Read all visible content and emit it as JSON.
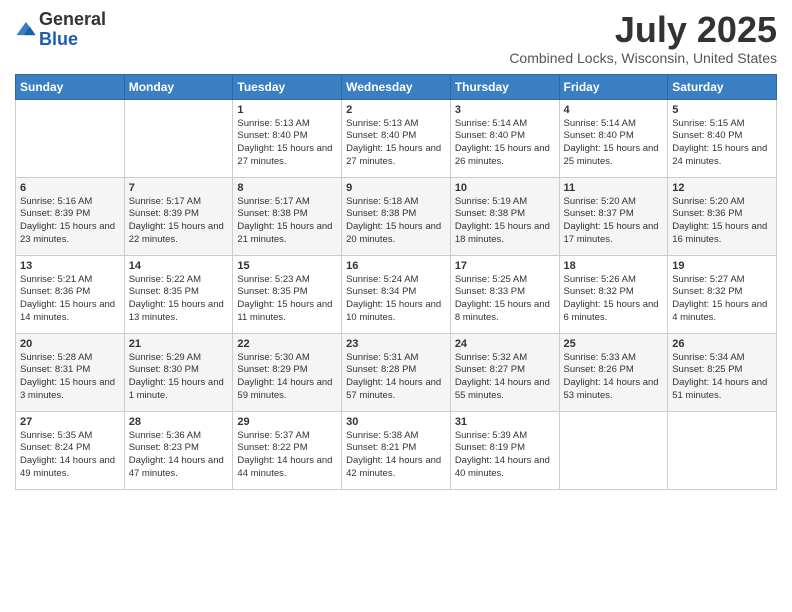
{
  "header": {
    "logo_general": "General",
    "logo_blue": "Blue",
    "month_year": "July 2025",
    "location": "Combined Locks, Wisconsin, United States"
  },
  "days_of_week": [
    "Sunday",
    "Monday",
    "Tuesday",
    "Wednesday",
    "Thursday",
    "Friday",
    "Saturday"
  ],
  "weeks": [
    [
      {
        "day": "",
        "sunrise": "",
        "sunset": "",
        "daylight": ""
      },
      {
        "day": "",
        "sunrise": "",
        "sunset": "",
        "daylight": ""
      },
      {
        "day": "1",
        "sunrise": "Sunrise: 5:13 AM",
        "sunset": "Sunset: 8:40 PM",
        "daylight": "Daylight: 15 hours and 27 minutes."
      },
      {
        "day": "2",
        "sunrise": "Sunrise: 5:13 AM",
        "sunset": "Sunset: 8:40 PM",
        "daylight": "Daylight: 15 hours and 27 minutes."
      },
      {
        "day": "3",
        "sunrise": "Sunrise: 5:14 AM",
        "sunset": "Sunset: 8:40 PM",
        "daylight": "Daylight: 15 hours and 26 minutes."
      },
      {
        "day": "4",
        "sunrise": "Sunrise: 5:14 AM",
        "sunset": "Sunset: 8:40 PM",
        "daylight": "Daylight: 15 hours and 25 minutes."
      },
      {
        "day": "5",
        "sunrise": "Sunrise: 5:15 AM",
        "sunset": "Sunset: 8:40 PM",
        "daylight": "Daylight: 15 hours and 24 minutes."
      }
    ],
    [
      {
        "day": "6",
        "sunrise": "Sunrise: 5:16 AM",
        "sunset": "Sunset: 8:39 PM",
        "daylight": "Daylight: 15 hours and 23 minutes."
      },
      {
        "day": "7",
        "sunrise": "Sunrise: 5:17 AM",
        "sunset": "Sunset: 8:39 PM",
        "daylight": "Daylight: 15 hours and 22 minutes."
      },
      {
        "day": "8",
        "sunrise": "Sunrise: 5:17 AM",
        "sunset": "Sunset: 8:38 PM",
        "daylight": "Daylight: 15 hours and 21 minutes."
      },
      {
        "day": "9",
        "sunrise": "Sunrise: 5:18 AM",
        "sunset": "Sunset: 8:38 PM",
        "daylight": "Daylight: 15 hours and 20 minutes."
      },
      {
        "day": "10",
        "sunrise": "Sunrise: 5:19 AM",
        "sunset": "Sunset: 8:38 PM",
        "daylight": "Daylight: 15 hours and 18 minutes."
      },
      {
        "day": "11",
        "sunrise": "Sunrise: 5:20 AM",
        "sunset": "Sunset: 8:37 PM",
        "daylight": "Daylight: 15 hours and 17 minutes."
      },
      {
        "day": "12",
        "sunrise": "Sunrise: 5:20 AM",
        "sunset": "Sunset: 8:36 PM",
        "daylight": "Daylight: 15 hours and 16 minutes."
      }
    ],
    [
      {
        "day": "13",
        "sunrise": "Sunrise: 5:21 AM",
        "sunset": "Sunset: 8:36 PM",
        "daylight": "Daylight: 15 hours and 14 minutes."
      },
      {
        "day": "14",
        "sunrise": "Sunrise: 5:22 AM",
        "sunset": "Sunset: 8:35 PM",
        "daylight": "Daylight: 15 hours and 13 minutes."
      },
      {
        "day": "15",
        "sunrise": "Sunrise: 5:23 AM",
        "sunset": "Sunset: 8:35 PM",
        "daylight": "Daylight: 15 hours and 11 minutes."
      },
      {
        "day": "16",
        "sunrise": "Sunrise: 5:24 AM",
        "sunset": "Sunset: 8:34 PM",
        "daylight": "Daylight: 15 hours and 10 minutes."
      },
      {
        "day": "17",
        "sunrise": "Sunrise: 5:25 AM",
        "sunset": "Sunset: 8:33 PM",
        "daylight": "Daylight: 15 hours and 8 minutes."
      },
      {
        "day": "18",
        "sunrise": "Sunrise: 5:26 AM",
        "sunset": "Sunset: 8:32 PM",
        "daylight": "Daylight: 15 hours and 6 minutes."
      },
      {
        "day": "19",
        "sunrise": "Sunrise: 5:27 AM",
        "sunset": "Sunset: 8:32 PM",
        "daylight": "Daylight: 15 hours and 4 minutes."
      }
    ],
    [
      {
        "day": "20",
        "sunrise": "Sunrise: 5:28 AM",
        "sunset": "Sunset: 8:31 PM",
        "daylight": "Daylight: 15 hours and 3 minutes."
      },
      {
        "day": "21",
        "sunrise": "Sunrise: 5:29 AM",
        "sunset": "Sunset: 8:30 PM",
        "daylight": "Daylight: 15 hours and 1 minute."
      },
      {
        "day": "22",
        "sunrise": "Sunrise: 5:30 AM",
        "sunset": "Sunset: 8:29 PM",
        "daylight": "Daylight: 14 hours and 59 minutes."
      },
      {
        "day": "23",
        "sunrise": "Sunrise: 5:31 AM",
        "sunset": "Sunset: 8:28 PM",
        "daylight": "Daylight: 14 hours and 57 minutes."
      },
      {
        "day": "24",
        "sunrise": "Sunrise: 5:32 AM",
        "sunset": "Sunset: 8:27 PM",
        "daylight": "Daylight: 14 hours and 55 minutes."
      },
      {
        "day": "25",
        "sunrise": "Sunrise: 5:33 AM",
        "sunset": "Sunset: 8:26 PM",
        "daylight": "Daylight: 14 hours and 53 minutes."
      },
      {
        "day": "26",
        "sunrise": "Sunrise: 5:34 AM",
        "sunset": "Sunset: 8:25 PM",
        "daylight": "Daylight: 14 hours and 51 minutes."
      }
    ],
    [
      {
        "day": "27",
        "sunrise": "Sunrise: 5:35 AM",
        "sunset": "Sunset: 8:24 PM",
        "daylight": "Daylight: 14 hours and 49 minutes."
      },
      {
        "day": "28",
        "sunrise": "Sunrise: 5:36 AM",
        "sunset": "Sunset: 8:23 PM",
        "daylight": "Daylight: 14 hours and 47 minutes."
      },
      {
        "day": "29",
        "sunrise": "Sunrise: 5:37 AM",
        "sunset": "Sunset: 8:22 PM",
        "daylight": "Daylight: 14 hours and 44 minutes."
      },
      {
        "day": "30",
        "sunrise": "Sunrise: 5:38 AM",
        "sunset": "Sunset: 8:21 PM",
        "daylight": "Daylight: 14 hours and 42 minutes."
      },
      {
        "day": "31",
        "sunrise": "Sunrise: 5:39 AM",
        "sunset": "Sunset: 8:19 PM",
        "daylight": "Daylight: 14 hours and 40 minutes."
      },
      {
        "day": "",
        "sunrise": "",
        "sunset": "",
        "daylight": ""
      },
      {
        "day": "",
        "sunrise": "",
        "sunset": "",
        "daylight": ""
      }
    ]
  ]
}
